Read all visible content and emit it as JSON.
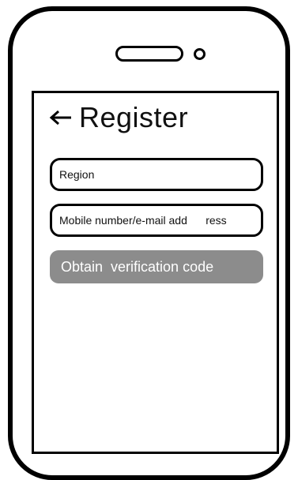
{
  "header": {
    "title": "Register",
    "back_icon": "arrow-left-icon"
  },
  "form": {
    "region_field": {
      "value": "Region"
    },
    "mobile_field": {
      "value": "Mobile number/e-mail add      ress"
    },
    "obtain_button": {
      "label": "Obtain  verification code"
    }
  },
  "colors": {
    "outline": "#000000",
    "button_background": "#8c8c8c",
    "button_text": "#ffffff"
  }
}
